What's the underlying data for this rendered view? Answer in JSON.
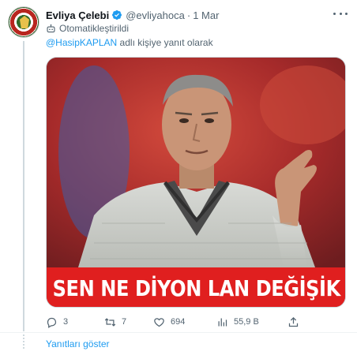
{
  "tweet": {
    "author_name": "Evliya Çelebi",
    "handle": "@evliyahoca",
    "separator": "·",
    "date": "1 Mar",
    "automated_label": "Otomatikleştirildi",
    "reply_mention": "@HasipKAPLAN",
    "reply_suffix": " adlı kişiye yanıt olarak",
    "image_caption": "SEN NE DİYON LAN DEĞİŞİK",
    "icons": {
      "verified": "verified-badge-icon",
      "more": "more-options-icon",
      "automated": "robot-icon"
    },
    "colors": {
      "accent": "#1d9bf0",
      "secondary_text": "#536471",
      "caption_bar": "#e01f1f"
    }
  },
  "actions": {
    "reply_count": "3",
    "retweet_count": "7",
    "like_count": "694",
    "view_count": "55,9 B"
  },
  "footer": {
    "show_replies": "Yanıtları göster"
  }
}
